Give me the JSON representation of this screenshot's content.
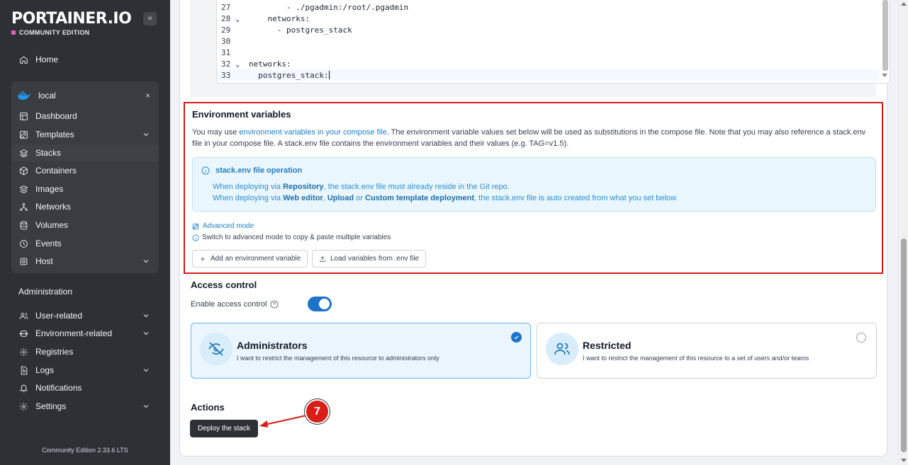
{
  "brand": {
    "name": "PORTAINER.IO",
    "edition": "COMMUNITY EDITION",
    "collapse_icon": "double-chevron-left-icon"
  },
  "sidebar": {
    "home": "Home",
    "environment": {
      "name": "local",
      "close": "×",
      "icon": "docker-whale-icon"
    },
    "env_items": [
      {
        "label": "Dashboard",
        "icon": "dashboard-icon"
      },
      {
        "label": "Templates",
        "icon": "templates-icon",
        "expandable": true
      },
      {
        "label": "Stacks",
        "icon": "stacks-icon",
        "active": true
      },
      {
        "label": "Containers",
        "icon": "containers-icon"
      },
      {
        "label": "Images",
        "icon": "images-icon"
      },
      {
        "label": "Networks",
        "icon": "networks-icon"
      },
      {
        "label": "Volumes",
        "icon": "volumes-icon"
      },
      {
        "label": "Events",
        "icon": "events-icon"
      },
      {
        "label": "Host",
        "icon": "host-icon",
        "expandable": true
      }
    ],
    "admin_label": "Administration",
    "admin_items": [
      {
        "label": "User-related",
        "icon": "users-icon",
        "expandable": true
      },
      {
        "label": "Environment-related",
        "icon": "environment-icon",
        "expandable": true
      },
      {
        "label": "Registries",
        "icon": "registries-icon"
      },
      {
        "label": "Logs",
        "icon": "logs-icon",
        "expandable": true
      },
      {
        "label": "Notifications",
        "icon": "bell-icon"
      },
      {
        "label": "Settings",
        "icon": "gear-icon",
        "expandable": true
      }
    ],
    "footer": "Community Edition 2.33.6 LTS"
  },
  "editor": {
    "lines": [
      {
        "n": "27",
        "fold": "",
        "text": "        - ./pgadmin:/root/.pgadmin"
      },
      {
        "n": "28",
        "fold": "⌄",
        "text": "    networks:"
      },
      {
        "n": "29",
        "fold": "",
        "text": "      - postgres_stack"
      },
      {
        "n": "30",
        "fold": "",
        "text": ""
      },
      {
        "n": "31",
        "fold": "",
        "text": ""
      },
      {
        "n": "32",
        "fold": "⌄",
        "text": "networks:"
      },
      {
        "n": "33",
        "fold": "",
        "text": "  postgres_stack:"
      }
    ]
  },
  "env_vars": {
    "title": "Environment variables",
    "desc_pre": "You may use ",
    "desc_link": "environment variables in your compose file",
    "desc_post": ". The environment variable values set below will be used as substitutions in the compose file. Note that you may also reference a stack.env file in your compose file. A stack.env file contains the environment variables and their values (e.g. TAG=v1.5).",
    "info": {
      "title": "stack.env file operation",
      "line1_pre": "When deploying via ",
      "line1_b1": "Repository",
      "line1_post": ", the stack.env file must already reside in the Git repo.",
      "line2_pre": "When deploying via ",
      "line2_b1": "Web editor",
      "line2_sep1": ", ",
      "line2_b2": "Upload",
      "line2_sep2": " or ",
      "line2_b3": "Custom template deployment",
      "line2_post": ", the stack.env file is auto created from what you set below."
    },
    "advanced_mode": "Advanced mode",
    "advanced_hint": "Switch to advanced mode to copy & paste multiple variables",
    "add_button": "Add an environment variable",
    "load_button": "Load variables from .env file"
  },
  "access_control": {
    "title": "Access control",
    "enable_label": "Enable access control",
    "enabled": true,
    "options": [
      {
        "title": "Administrators",
        "desc": "I want to restrict the management of this resource to administrators only",
        "selected": true,
        "icon": "eye-off-icon"
      },
      {
        "title": "Restricted",
        "desc": "I want to restrict the management of this resource to a set of users and/or teams",
        "selected": false,
        "icon": "users-icon"
      }
    ]
  },
  "actions": {
    "title": "Actions",
    "deploy_button": "Deploy the stack"
  },
  "annotation": {
    "step": "7"
  },
  "colors": {
    "accent": "#1c73c9",
    "highlight_border": "#d11a1a",
    "sidebar_bg": "#2d3136"
  }
}
